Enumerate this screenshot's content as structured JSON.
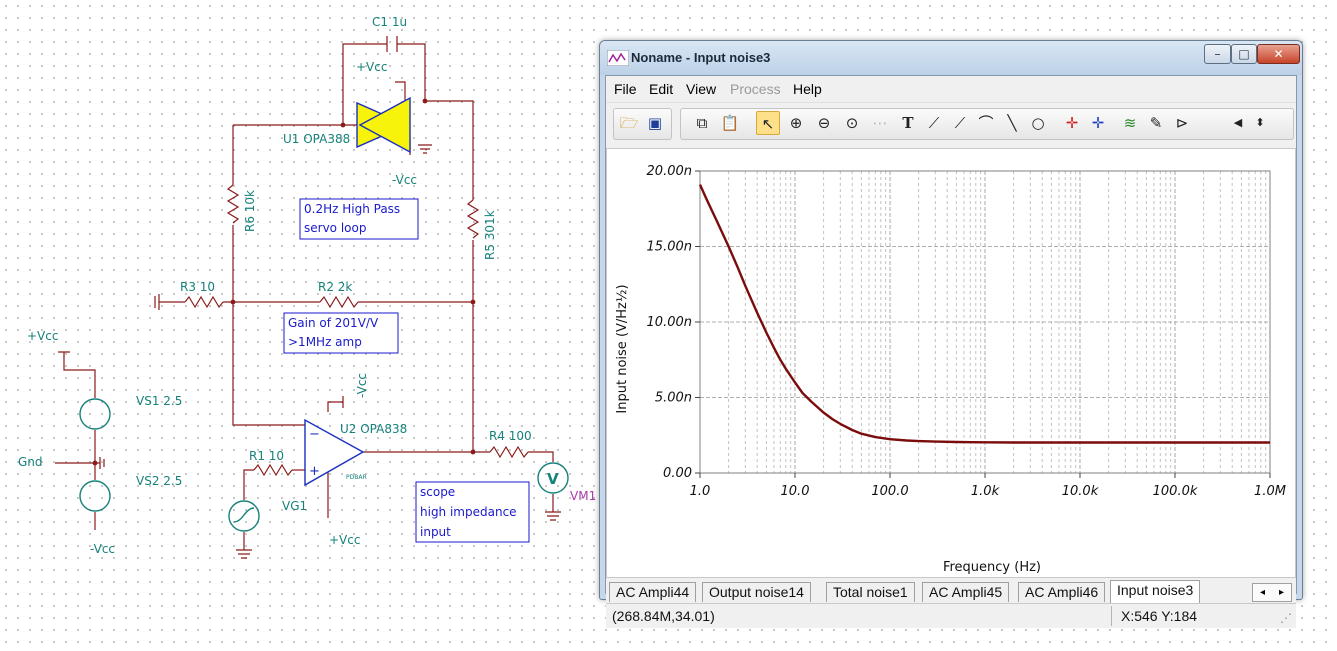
{
  "schematic": {
    "labels": {
      "c1": "C1 1u",
      "vcc_top": "+Vcc",
      "u1": "U1 OPA388",
      "vcc_neg_u1": "-Vcc",
      "r6": "R6 10k",
      "r5": "R5 301k",
      "r3": "R3 10",
      "r2": "R2 2k",
      "vcc_left": "+Vcc",
      "vs1": "VS1 2.5",
      "gnd": "Gnd",
      "vs2": "VS2 2.5",
      "vcc_neg_left": "-Vcc",
      "vcc_neg_u2": "-Vcc",
      "u2": "U2 OPA838",
      "r1": "R1 10",
      "vg1": "VG1",
      "vcc_u2": "+Vcc",
      "r4": "R4 100",
      "vm1": "VM1",
      "pdbar": "PDBAR",
      "vm_symbol": "V"
    },
    "notes": {
      "highpass_line1": "0.2Hz High Pass",
      "highpass_line2": "servo loop",
      "gain_line1": "Gain of 201V/V",
      "gain_line2": ">1MHz amp",
      "scope_line1": "scope",
      "scope_line2": "high impedance",
      "scope_line3": "input"
    }
  },
  "window": {
    "title": "Noname - Input noise3",
    "controls": {
      "minimize": "–",
      "maximize": "□",
      "close": "✕"
    },
    "menu": [
      {
        "label": "File",
        "enabled": true
      },
      {
        "label": "Edit",
        "enabled": true
      },
      {
        "label": "View",
        "enabled": true
      },
      {
        "label": "Process",
        "enabled": false
      },
      {
        "label": "Help",
        "enabled": true
      }
    ],
    "toolbar_icons": [
      "open-icon",
      "save-icon",
      "copy-icon",
      "paste-icon",
      "pointer-icon",
      "zoom-in-icon",
      "zoom-out-icon",
      "zoom-100-icon",
      "grid-icon",
      "text-icon",
      "label-icon",
      "label-alt-icon",
      "formula-icon",
      "line-icon",
      "circle-icon",
      "cursor-a-icon",
      "cursor-b-icon",
      "add-curve-icon",
      "pen-icon",
      "flag-icon",
      "scroll-left-icon",
      "scroll-updown-icon"
    ],
    "tabs": [
      {
        "label": "AC Ampli44",
        "selected": false
      },
      {
        "label": "Output noise14",
        "selected": false
      },
      {
        "label": "Total noise1",
        "selected": false
      },
      {
        "label": "AC Ampli45",
        "selected": false
      },
      {
        "label": "AC Ampli46",
        "selected": false
      },
      {
        "label": "Input noise3",
        "selected": true
      }
    ],
    "tab_nav": {
      "left": "◂",
      "right": "▸"
    },
    "status": {
      "coords": "(268.84M,34.01)",
      "cursor": "X:546  Y:184"
    }
  },
  "chart_data": {
    "type": "line",
    "xscale": "log",
    "xlabel": "Frequency (Hz)",
    "ylabel": "Input noise (V/Hz½)",
    "xlim": [
      1,
      1000000
    ],
    "ylim": [
      0,
      20
    ],
    "x_ticks": [
      "1.0",
      "10.0",
      "100.0",
      "1.0k",
      "10.0k",
      "100.0k",
      "1.0M"
    ],
    "y_ticks": [
      "0.00",
      "5.00n",
      "10.00n",
      "15.00n",
      "20.00n"
    ],
    "line_color": "#7b0c0c",
    "grid": true,
    "series": [
      {
        "x": [
          1,
          1.2,
          1.5,
          2,
          2.5,
          3,
          4,
          5,
          6,
          7,
          8,
          10,
          12,
          15,
          20,
          25,
          30,
          40,
          50,
          70,
          100,
          150,
          200,
          300,
          500,
          700,
          1000,
          2000,
          5000,
          10000,
          100000,
          1000000
        ],
        "y": [
          19.1,
          18.0,
          16.7,
          15.0,
          13.6,
          12.4,
          10.6,
          9.3,
          8.3,
          7.5,
          6.9,
          6.0,
          5.3,
          4.7,
          4.0,
          3.55,
          3.25,
          2.85,
          2.6,
          2.38,
          2.24,
          2.15,
          2.11,
          2.08,
          2.05,
          2.04,
          2.03,
          2.02,
          2.02,
          2.02,
          2.02,
          2.02
        ]
      }
    ]
  }
}
